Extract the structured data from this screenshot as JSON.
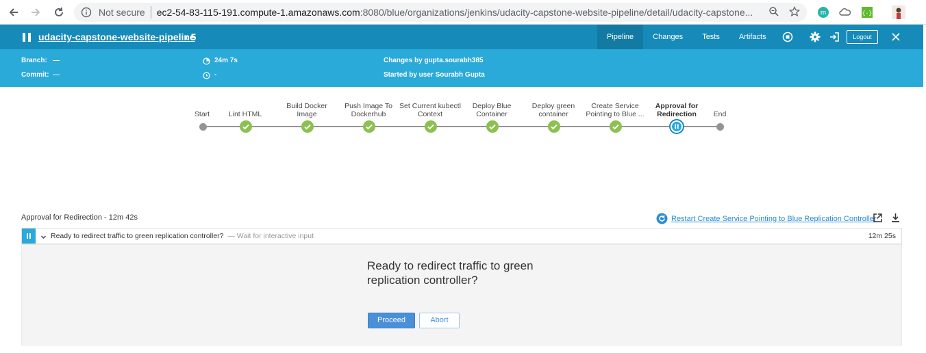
{
  "browser": {
    "security_label": "Not secure",
    "url_host": "ec2-54-83-115-191.compute-1.amazonaws.com",
    "url_path": ":8080/blue/organizations/jenkins/udacity-capstone-website-pipeline/detail/udacity-capstone..."
  },
  "header": {
    "pipeline_name": "udacity-capstone-website-pipeline",
    "run_number": "5",
    "tabs": [
      "Pipeline",
      "Changes",
      "Tests",
      "Artifacts"
    ],
    "logout_label": "Logout"
  },
  "info": {
    "branch_label": "Branch:",
    "branch_value": "—",
    "commit_label": "Commit:",
    "commit_value": "—",
    "duration": "24m 7s",
    "finished": "-",
    "changes_by": "Changes by gupta.sourabh385",
    "started_by": "Started by user Sourabh Gupta"
  },
  "stages": [
    {
      "label": "Start",
      "status": "start"
    },
    {
      "label": "Lint HTML",
      "status": "success"
    },
    {
      "label": "Build Docker Image",
      "status": "success"
    },
    {
      "label": "Push Image To Dockerhub",
      "status": "success"
    },
    {
      "label": "Set Current kubectl Context",
      "status": "success"
    },
    {
      "label": "Deploy Blue Container",
      "status": "success"
    },
    {
      "label": "Deploy green container",
      "status": "success"
    },
    {
      "label": "Create Service Pointing to Blue ...",
      "status": "success"
    },
    {
      "label": "Approval for Redirection",
      "status": "paused"
    },
    {
      "label": "End",
      "status": "end"
    }
  ],
  "step": {
    "title": "Approval for Redirection - 12m 42s",
    "restart_label": "Restart Create Service Pointing to Blue Replication Controller",
    "log_text": "Ready to redirect traffic to green replication controller?",
    "log_wait": "— Wait for interactive input",
    "log_time": "12m 25s",
    "question": "Ready to redirect traffic to green replication controller?",
    "proceed_label": "Proceed",
    "abort_label": "Abort"
  },
  "colors": {
    "header_bg": "#168bb9",
    "infobar_bg": "#2aaad8",
    "success": "#8cc04f",
    "proceed": "#4a90d9"
  }
}
